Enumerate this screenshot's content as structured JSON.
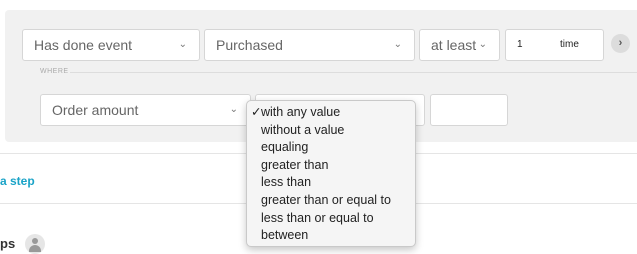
{
  "filter": {
    "event_condition": "Has done event",
    "event_name": "Purchased",
    "frequency_operator": "at least",
    "count_value": "1",
    "count_unit": "time",
    "next_icon": "chevron-right-icon"
  },
  "where": {
    "label": "WHERE",
    "property": "Order amount"
  },
  "dropdown": {
    "selected": "with any value",
    "options": [
      "with any value",
      "without a value",
      "equaling",
      "greater than",
      "less than",
      "greater than or equal to",
      "less than or equal to",
      "between"
    ]
  },
  "add_step_link": "a step",
  "section": {
    "title": "ps",
    "avatar_icon": "user-icon"
  },
  "colors": {
    "accent": "#1aa3c7",
    "panel_bg": "#f1f1f1"
  }
}
